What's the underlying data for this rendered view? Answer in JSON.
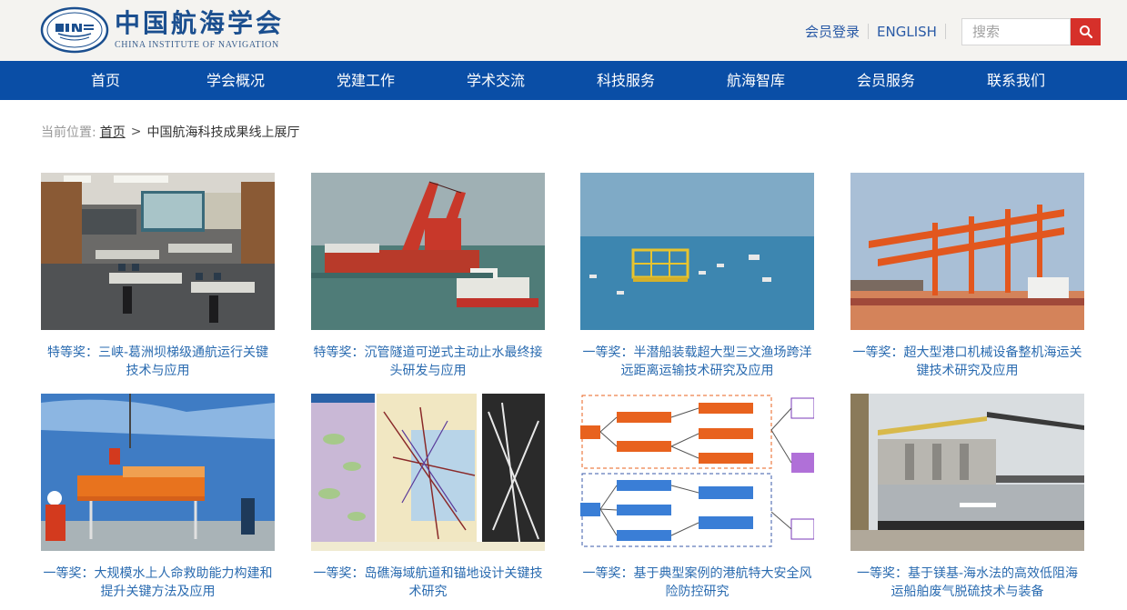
{
  "header": {
    "org_name_cn": "中国航海学会",
    "org_name_en": "CHINA INSTITUTE OF NAVIGATION",
    "member_login": "会员登录",
    "english": "ENGLISH",
    "search_placeholder": "搜索",
    "search_icon": "search-icon"
  },
  "nav": {
    "items": [
      "首页",
      "学会概况",
      "党建工作",
      "学术交流",
      "科技服务",
      "航海智库",
      "会员服务",
      "联系我们"
    ]
  },
  "breadcrumb": {
    "label": "当前位置:",
    "home": "首页",
    "separator": ">",
    "current": "中国航海科技成果线上展厅"
  },
  "gallery": [
    {
      "caption": "特等奖：三峡-葛洲坝梯级通航运行关键技术与应用",
      "image": "control-room-photo"
    },
    {
      "caption": "特等奖：沉管隧道可逆式主动止水最终接头研发与应用",
      "image": "crane-vessel-photo"
    },
    {
      "caption": "一等奖：半潜船装载超大型三文渔场跨洋远距离运输技术研究及应用",
      "image": "offshore-fish-farm-photo"
    },
    {
      "caption": "一等奖：超大型港口机械设备整机海运关键技术研究及应用",
      "image": "port-cranes-photo"
    },
    {
      "caption": "一等奖：大规模水上人命救助能力构建和提升关键方法及应用",
      "image": "liferaft-rescue-photo"
    },
    {
      "caption": "一等奖：岛礁海域航道和锚地设计关键技术研究",
      "image": "channel-chart-image"
    },
    {
      "caption": "一等奖：基于典型案例的港航特大安全风险防控研究",
      "image": "flowchart-diagram-image"
    },
    {
      "caption": "一等奖：基于镁基-海水法的高效低阻海运船舶废气脱硫技术与装备",
      "image": "container-ship-photo"
    }
  ],
  "colors": {
    "nav_bg": "#0a4ea6",
    "header_bg": "#f4f3f0",
    "search_btn": "#d6302a",
    "caption_text": "#2a6bb0",
    "brand_blue": "#1b4f8f"
  }
}
